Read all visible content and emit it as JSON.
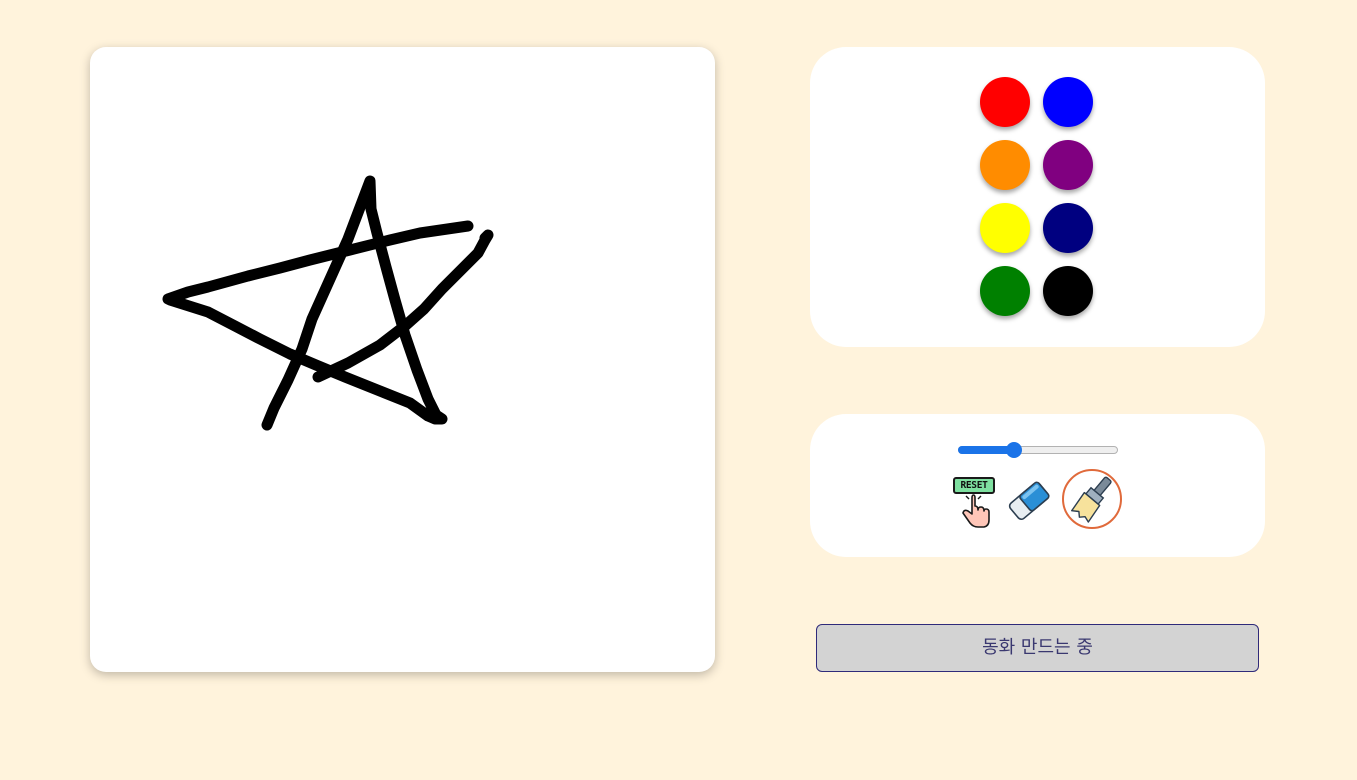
{
  "palette": {
    "colors": [
      "#ff0000",
      "#0000ff",
      "#ff8c00",
      "#800080",
      "#ffff00",
      "#000080",
      "#008000",
      "#000000"
    ]
  },
  "tools": {
    "brush_size_fraction": 0.35,
    "reset_label": "RESET",
    "reset_icon": "reset-hand-icon",
    "eraser_icon": "eraser-icon",
    "brush_icon": "paint-brush-icon",
    "selected_tool": "brush",
    "accent_color": "#e06a3b"
  },
  "status_button": {
    "label": "동화 만드는 중"
  },
  "drawing": {
    "stroke_color": "#000000",
    "shape": "star"
  }
}
